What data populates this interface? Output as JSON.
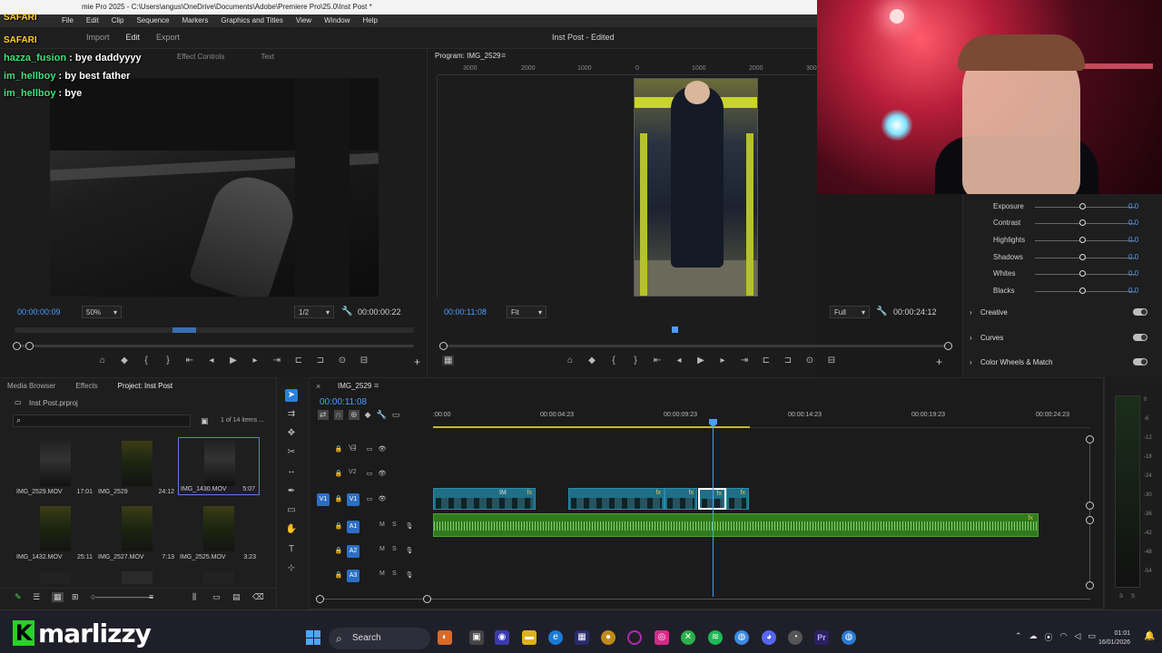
{
  "window": {
    "title": "Adobe Premiere Pro 2025 - C:\\Users\\angus\\OneDrive\\Documents\\Adobe\\Premiere Pro\\25.0\\Inst Post *",
    "title_visible": "mie Pro 2025 - C:\\Users\\angus\\OneDrive\\Documents\\Adobe\\Premiere Pro\\25.0\\Inst Post *"
  },
  "menu": [
    "File",
    "Edit",
    "Clip",
    "Sequence",
    "Markers",
    "Graphics and Titles",
    "View",
    "Window",
    "Help"
  ],
  "header": {
    "modes": [
      "Import",
      "Edit",
      "Export"
    ],
    "document_title": "Inst Post - Edited"
  },
  "chat": {
    "tag": "SAFARI",
    "messages": [
      {
        "user": "hazza_fusion",
        "text": "bye daddyyyy"
      },
      {
        "user": "im_hellboy",
        "text": "by best father"
      },
      {
        "user": "im_hellboy",
        "text": "bye"
      }
    ]
  },
  "source_monitor": {
    "tabs": [
      "Effect Controls",
      "Text"
    ],
    "timecode": "00:00:00:09",
    "zoom": "50%",
    "resolution": "1/2",
    "duration": "00:00:00:22"
  },
  "program_monitor": {
    "title": "Program: IMG_2529",
    "ruler": [
      "3000",
      "2000",
      "1000",
      "0",
      "1000",
      "2000",
      "3000"
    ],
    "timecode": "00:00:11:08",
    "fit": "Fit",
    "quality": "Full",
    "duration": "00:00:24:12"
  },
  "lumetri": {
    "sliders": [
      {
        "label": "Exposure",
        "value": "0.0"
      },
      {
        "label": "Contrast",
        "value": "0.0"
      },
      {
        "label": "Highlights",
        "value": "0.0"
      },
      {
        "label": "Shadows",
        "value": "0.0"
      },
      {
        "label": "Whites",
        "value": "0.0"
      },
      {
        "label": "Blacks",
        "value": "0.0"
      }
    ],
    "sections": [
      "Creative",
      "Curves",
      "Color Wheels & Match"
    ]
  },
  "project": {
    "tabs": [
      "Media Browser",
      "Effects",
      "Project: Inst Post"
    ],
    "file": "Inst Post.prproj",
    "items_count": "1 of 14 items ...",
    "items": [
      {
        "name": "IMG_2529.MOV",
        "duration": "17:01"
      },
      {
        "name": "IMG_2529",
        "duration": "24:12"
      },
      {
        "name": "IMG_1430.MOV",
        "duration": "5:07"
      },
      {
        "name": "IMG_1432.MOV",
        "duration": "25:11"
      },
      {
        "name": "IMG_2527.MOV",
        "duration": "7:13"
      },
      {
        "name": "IMG_2525.MOV",
        "duration": "3:23"
      }
    ]
  },
  "timeline": {
    "sequence": "IMG_2529",
    "timecode": "00:00:11:08",
    "ruler": [
      ":00:00",
      "00:00:04:23",
      "00:00:09:23",
      "00:00:14:23",
      "00:00:19:23",
      "00:00:24:23"
    ],
    "tracks": {
      "video": [
        {
          "name": "V3",
          "target": ""
        },
        {
          "name": "V2",
          "target": ""
        },
        {
          "name": "V1",
          "target": "V1"
        }
      ],
      "audio": [
        {
          "name": "A1",
          "m": "M",
          "s": "S"
        },
        {
          "name": "A2",
          "m": "M",
          "s": "S"
        },
        {
          "name": "A3",
          "m": "M",
          "s": "S"
        }
      ]
    },
    "clips": [
      {
        "label": "IM",
        "fx": "fx"
      },
      {
        "label": "",
        "fx": "fx"
      },
      {
        "label": "",
        "fx": "fx"
      },
      {
        "label": "",
        "fx": "fx"
      },
      {
        "label": "",
        "fx": "fx"
      }
    ],
    "audio_fx": "fx"
  },
  "meter": {
    "scale": [
      "0",
      "-6",
      "-12",
      "-18",
      "-24",
      "-30",
      "-36",
      "-42",
      "-48",
      "-54"
    ],
    "footer": [
      "S",
      "S"
    ]
  },
  "taskbar": {
    "logo_k": "K",
    "logo_name": "marlizzy",
    "search": "Search",
    "time": "01:01",
    "date": "16/01/2026"
  }
}
